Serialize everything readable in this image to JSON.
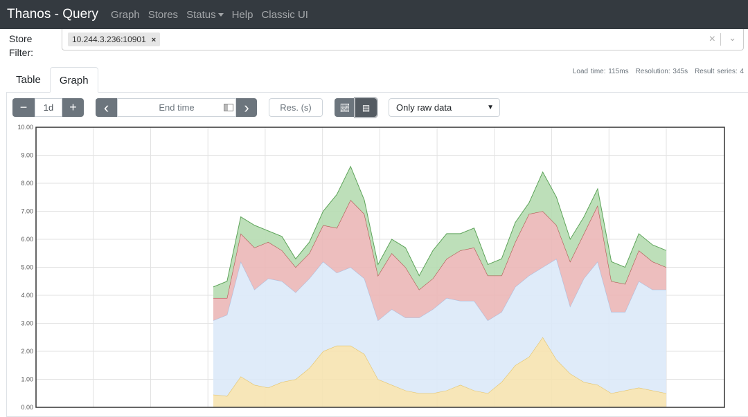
{
  "navbar": {
    "brand": "Thanos - Query",
    "links": [
      "Graph",
      "Stores",
      "Status",
      "Help",
      "Classic UI"
    ]
  },
  "store_filter": {
    "label_line1": "Store",
    "label_line2": "Filter:",
    "selected": [
      "10.244.3.236:10901"
    ],
    "chip_remove": "×",
    "clear": "×",
    "dropdown": "⌄"
  },
  "tabs": [
    {
      "label": "Table",
      "active": false
    },
    {
      "label": "Graph",
      "active": true
    }
  ],
  "stats": {
    "load_time": "Load time: 115ms",
    "resolution": "Resolution: 345s",
    "result_series": "Result series: 4"
  },
  "controls": {
    "minus": "−",
    "range": "1d",
    "plus": "+",
    "prev": "‹",
    "end_time_placeholder": "End time",
    "next": "›",
    "res_placeholder": "Res. (s)",
    "chart_mode": "stacked",
    "select_value": "Only raw data"
  },
  "chart_data": {
    "type": "area",
    "stacked": true,
    "grid": true,
    "ylim": [
      0,
      10
    ],
    "yticks": [
      "0.00",
      "1.00",
      "2.00",
      "3.00",
      "4.00",
      "5.00",
      "6.00",
      "7.00",
      "8.00",
      "9.00",
      "10.00"
    ],
    "series": [
      {
        "color": "#e6c15c",
        "fill": "#f6e3b0",
        "values": [
          0.45,
          0.4,
          1.1,
          0.8,
          0.7,
          0.9,
          1.0,
          1.4,
          2.0,
          2.2,
          2.2,
          1.9,
          1.0,
          0.8,
          0.6,
          0.5,
          0.5,
          0.6,
          0.8,
          0.6,
          0.5,
          0.9,
          1.5,
          1.8,
          2.5,
          1.7,
          1.2,
          0.9,
          0.8,
          0.5,
          0.6,
          0.7,
          0.6,
          0.5
        ]
      },
      {
        "color": "#a9c3e6",
        "fill": "#dbe9f8",
        "values": [
          2.65,
          2.9,
          4.1,
          3.4,
          3.9,
          3.6,
          3.1,
          3.2,
          3.2,
          2.6,
          2.8,
          2.7,
          2.1,
          2.7,
          2.6,
          2.7,
          3.0,
          3.3,
          3.0,
          3.2,
          2.6,
          2.5,
          2.8,
          2.9,
          2.5,
          3.6,
          2.4,
          3.7,
          4.4,
          2.9,
          2.8,
          3.8,
          3.6,
          3.7
        ]
      },
      {
        "color": "#b24a4a",
        "fill": "#ebb7b7",
        "values": [
          0.8,
          0.6,
          1.0,
          1.5,
          1.3,
          1.1,
          0.9,
          0.9,
          1.3,
          1.6,
          2.4,
          2.3,
          1.6,
          2.0,
          1.8,
          1.0,
          1.1,
          1.4,
          1.8,
          1.9,
          1.6,
          1.3,
          1.6,
          2.2,
          2.0,
          1.2,
          1.6,
          1.6,
          2.0,
          1.1,
          1.0,
          1.1,
          1.0,
          0.8
        ]
      },
      {
        "color": "#5ea45a",
        "fill": "#b6dcb1",
        "values": [
          0.4,
          0.6,
          0.6,
          0.8,
          0.4,
          0.5,
          0.3,
          0.4,
          0.5,
          1.2,
          1.2,
          0.5,
          0.4,
          0.5,
          0.7,
          0.5,
          1.0,
          0.9,
          0.6,
          0.7,
          0.4,
          0.6,
          0.7,
          0.4,
          1.4,
          1.0,
          0.8,
          0.6,
          0.6,
          0.7,
          0.6,
          0.6,
          0.6,
          0.6
        ]
      }
    ]
  }
}
